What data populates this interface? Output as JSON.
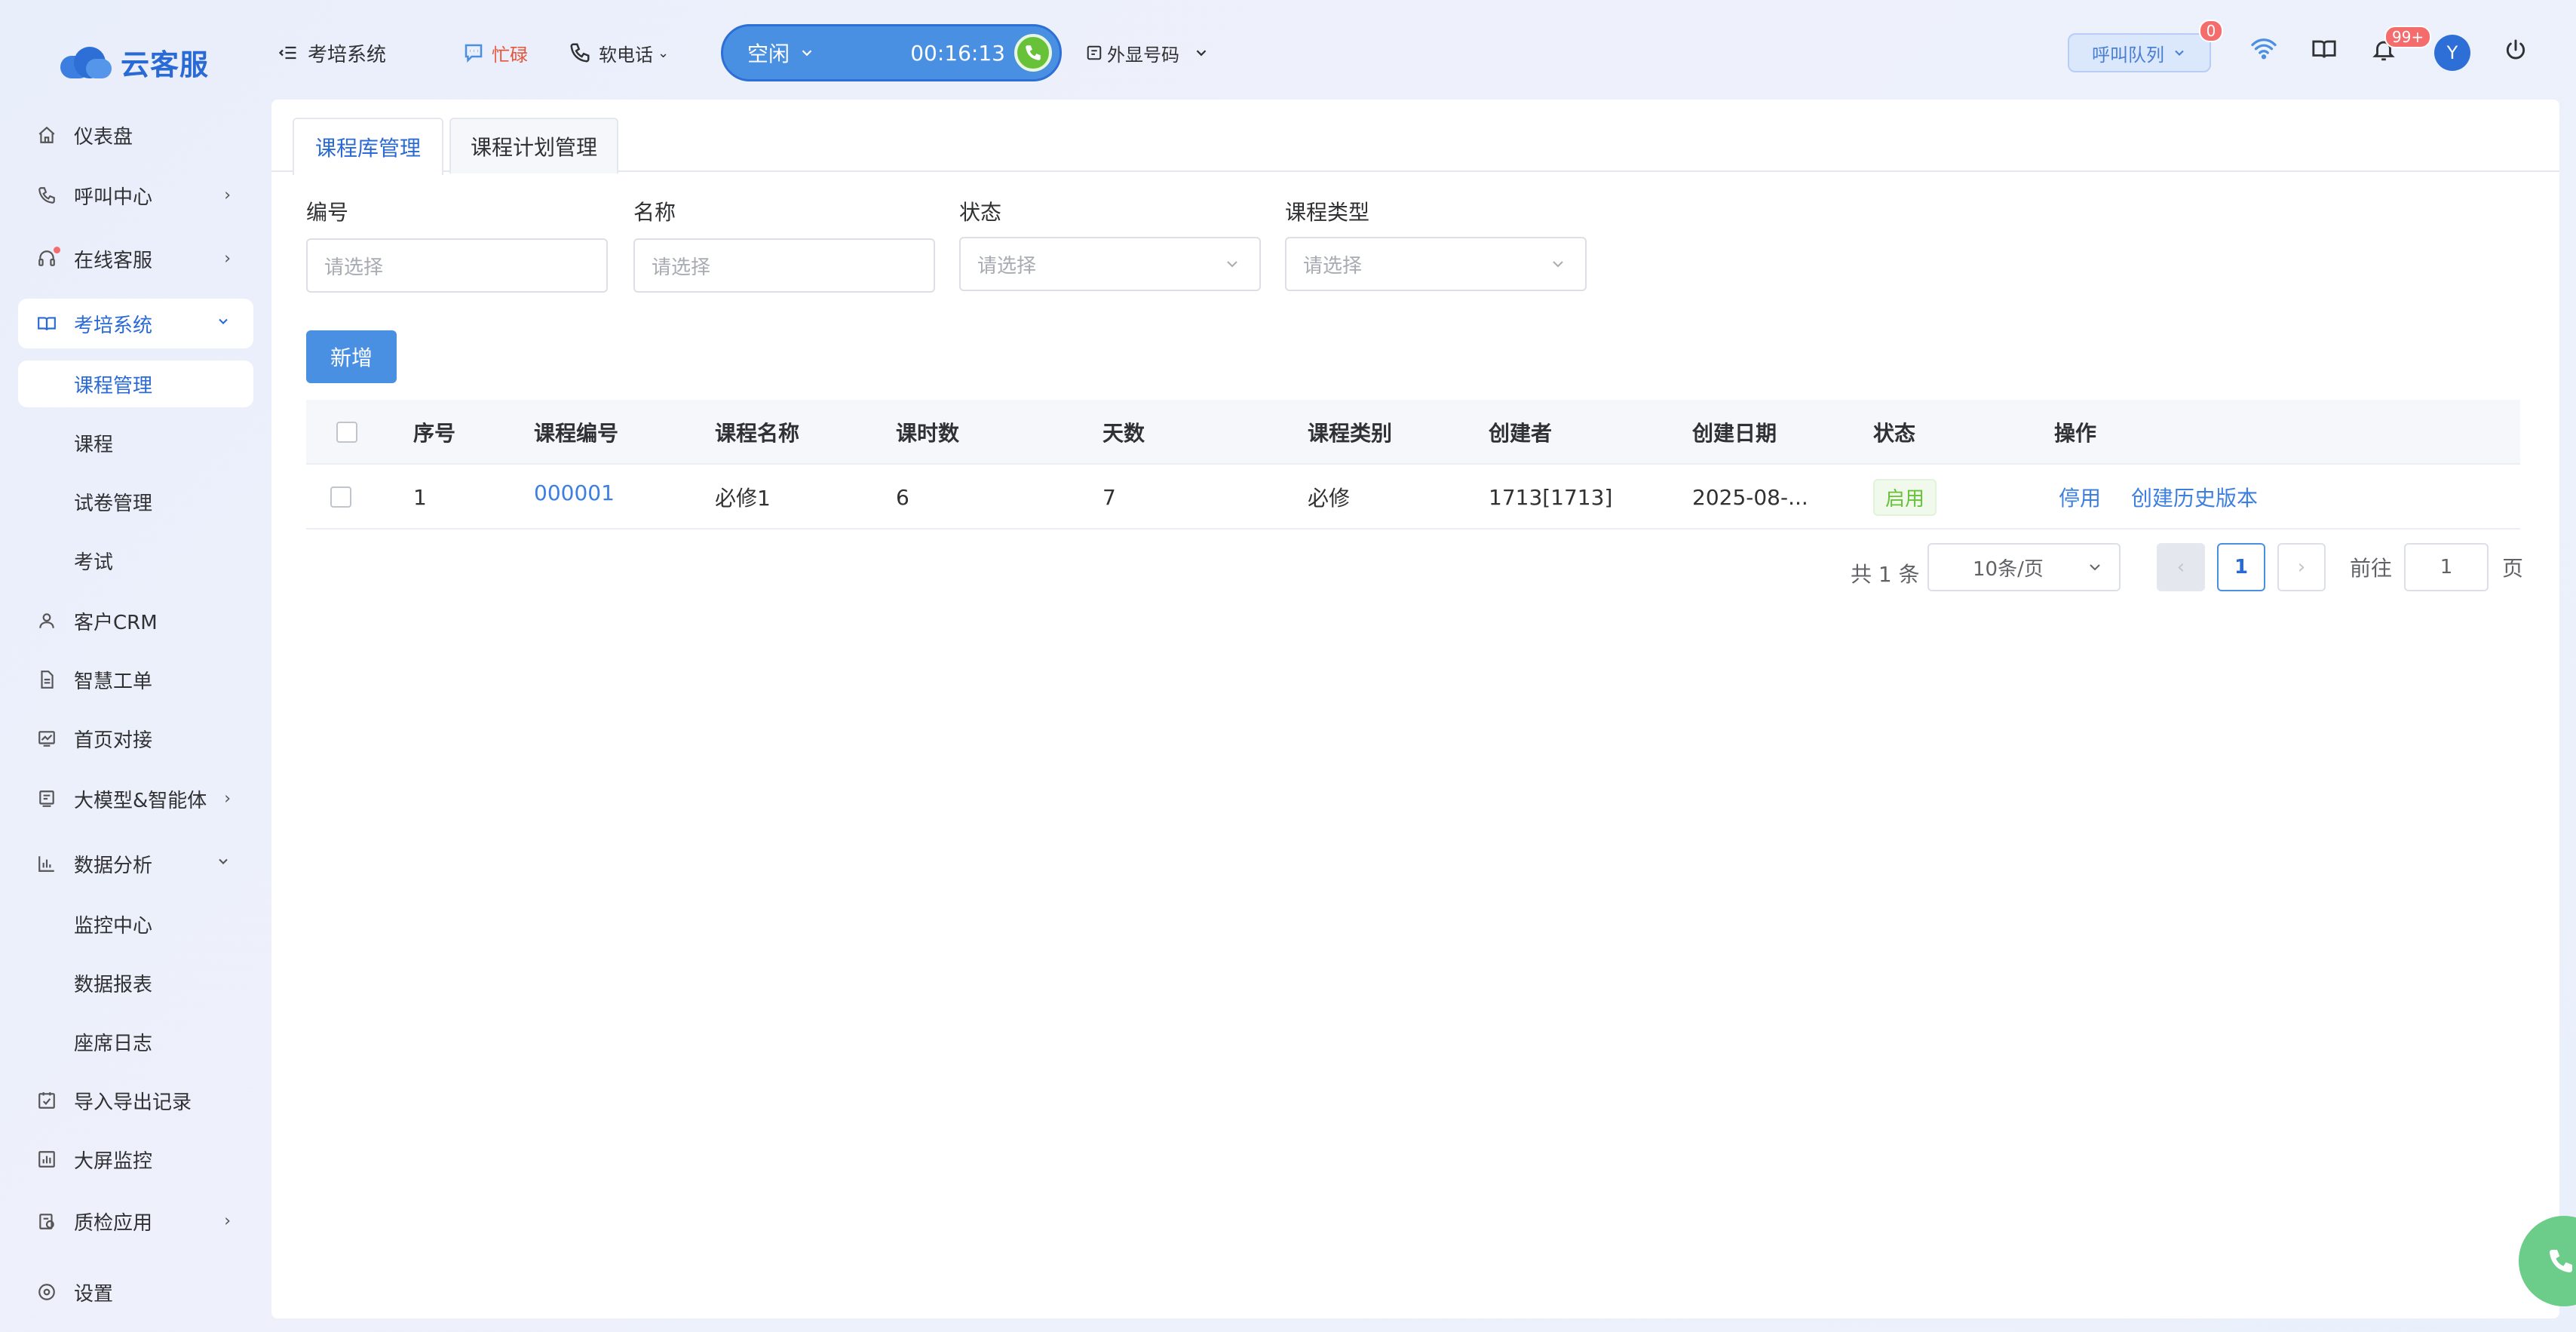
{
  "brand": {
    "name": "云客服"
  },
  "header": {
    "module_title": "考培系统",
    "busy_label": "忙碌",
    "softphone_label": "软电话",
    "status": "空闲",
    "timer": "00:16:13",
    "outbound_label": "外显号码",
    "queue_label": "呼叫队列",
    "queue_badge": "0",
    "notify_badge": "99+",
    "avatar_letter": "Y"
  },
  "sidebar": {
    "items": [
      {
        "label": "仪表盘"
      },
      {
        "label": "呼叫中心"
      },
      {
        "label": "在线客服"
      },
      {
        "label": "考培系统"
      },
      {
        "label": "客户CRM"
      },
      {
        "label": "智慧工单"
      },
      {
        "label": "首页对接"
      },
      {
        "label": "大模型&智能体"
      },
      {
        "label": "数据分析"
      },
      {
        "label": "导入导出记录"
      },
      {
        "label": "大屏监控"
      },
      {
        "label": "质检应用"
      },
      {
        "label": "设置"
      }
    ],
    "exam_sub": [
      {
        "label": "课程管理"
      },
      {
        "label": "课程"
      },
      {
        "label": "试卷管理"
      },
      {
        "label": "考试"
      }
    ],
    "data_sub": [
      {
        "label": "监控中心"
      },
      {
        "label": "数据报表"
      },
      {
        "label": "座席日志"
      }
    ]
  },
  "tabs": [
    {
      "label": "课程库管理"
    },
    {
      "label": "课程计划管理"
    }
  ],
  "filters": {
    "code": {
      "label": "编号",
      "placeholder": "请选择"
    },
    "name": {
      "label": "名称",
      "placeholder": "请选择"
    },
    "status": {
      "label": "状态",
      "placeholder": "请选择"
    },
    "type": {
      "label": "课程类型",
      "placeholder": "请选择"
    }
  },
  "actions": {
    "add_label": "新增"
  },
  "table": {
    "headers": [
      "序号",
      "课程编号",
      "课程名称",
      "课时数",
      "天数",
      "课程类别",
      "创建者",
      "创建日期",
      "状态",
      "操作"
    ],
    "rows": [
      {
        "index": "1",
        "code": "000001",
        "name": "必修1",
        "hours": "6",
        "days": "7",
        "category": "必修",
        "creator": "1713[1713]",
        "created": "2025-08-...",
        "status": "启用",
        "op_disable": "停用",
        "op_history": "创建历史版本"
      }
    ]
  },
  "pagination": {
    "total_text": "共 1 条",
    "page_size": "10条/页",
    "current_page": "1",
    "goto_label": "前往",
    "goto_value": "1",
    "page_suffix": "页"
  },
  "colors": {
    "accent": "#2a6ad4",
    "primary": "#4a90e2",
    "success": "#67c23a",
    "danger": "#f56c6c"
  }
}
